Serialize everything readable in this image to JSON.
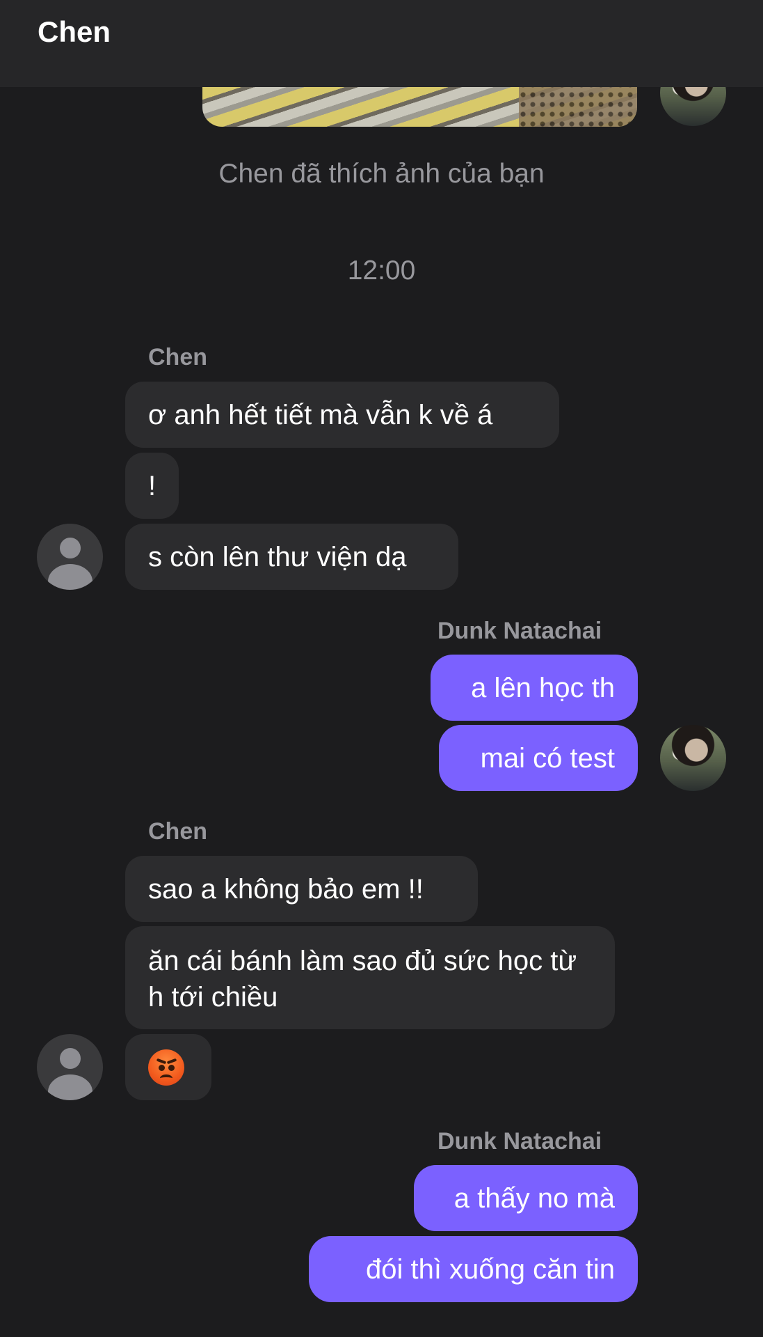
{
  "header": {
    "title": "Chen"
  },
  "notices": {
    "liked_photo": "Chen đã thích ảnh của bạn",
    "time": "12:00"
  },
  "conversation": {
    "group1": {
      "sender": "Chen",
      "messages": [
        "ơ anh hết tiết mà vẫn k về á",
        "!",
        "s còn lên thư viện dạ"
      ]
    },
    "group2": {
      "sender": "Dunk Natachai",
      "messages": [
        "a lên học th",
        "mai có test"
      ]
    },
    "group3": {
      "sender": "Chen",
      "messages": [
        "sao a không bảo em !!",
        "ăn cái bánh làm sao đủ sức học từ h tới chiều"
      ],
      "emoji": "angry-face-emoji"
    },
    "group4": {
      "sender": "Dunk Natachai",
      "messages": [
        "a thấy no mà",
        "đói thì xuống căn tin"
      ]
    }
  },
  "colors": {
    "background": "#1c1c1e",
    "header": "#262628",
    "incoming_bubble": "#2c2c2e",
    "outgoing_bubble": "#7b61ff",
    "muted_text": "#98989d"
  }
}
